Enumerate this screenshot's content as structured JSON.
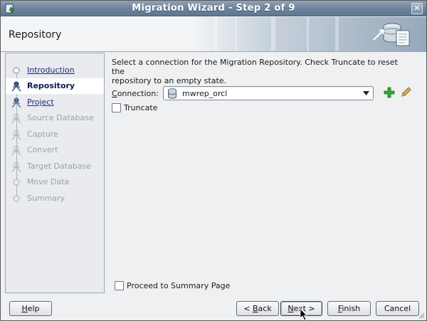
{
  "window": {
    "title": "Migration Wizard - Step 2 of 9",
    "close_glyph": "✕",
    "app_icon": "wizard-app-icon"
  },
  "header": {
    "step_title": "Repository",
    "graphic": "database-migration-graphic"
  },
  "nav": {
    "items": [
      {
        "label": "Introduction",
        "state": "done"
      },
      {
        "label": "Repository",
        "state": "current"
      },
      {
        "label": "Project",
        "state": "done"
      },
      {
        "label": "Source Database",
        "state": "future"
      },
      {
        "label": "Capture",
        "state": "future"
      },
      {
        "label": "Convert",
        "state": "future"
      },
      {
        "label": "Target Database",
        "state": "future"
      },
      {
        "label": "Move Data",
        "state": "future"
      },
      {
        "label": "Summary",
        "state": "future"
      }
    ]
  },
  "main": {
    "instructions_line1": "Select a connection for the Migration Repository.  Check Truncate to reset the",
    "instructions_line2": "repository to an empty state.",
    "connection_label_mnemonic": "C",
    "connection_label_rest": "onnection:",
    "connection_value": "mwrep_orcl",
    "truncate_label": "Truncate",
    "truncate_checked": false,
    "proceed_label": "Proceed to Summary Page",
    "proceed_checked": false
  },
  "buttons": {
    "help_mnemonic": "H",
    "help_rest": "elp",
    "back_prefix": "< ",
    "back_mnemonic": "B",
    "back_rest": "ack",
    "next_mnemonic": "N",
    "next_rest": "ext >",
    "finish_mnemonic": "F",
    "finish_rest": "inish",
    "cancel": "Cancel"
  },
  "colors": {
    "accent": "#1c2d78",
    "titlebar": "#6d849c",
    "add_icon": "#2fa52f"
  }
}
